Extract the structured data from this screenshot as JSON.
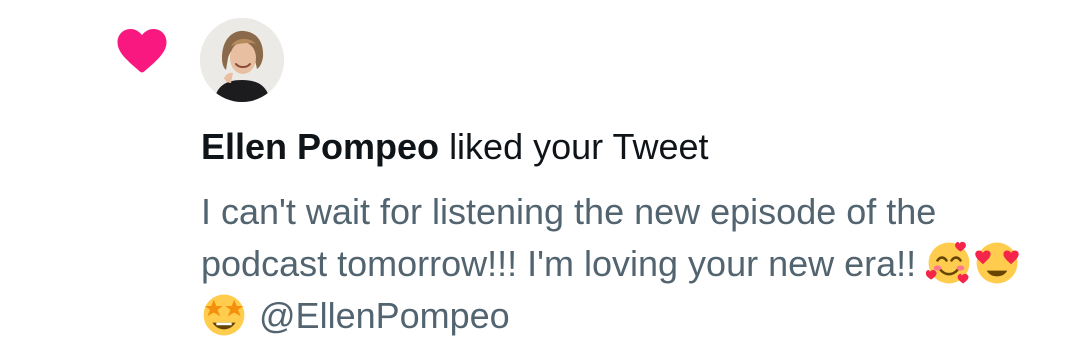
{
  "notification": {
    "type_icon": "heart-icon",
    "heart_color": "#f91880",
    "actor": {
      "name": "Ellen Pompeo",
      "avatar_icon": "user-avatar"
    },
    "action_text": "liked your Tweet",
    "tweet": {
      "text": "I can't wait for listening the new episode of the podcast tomorrow!!! I'm loving your new era!!",
      "emojis": [
        "smiling-face-with-hearts",
        "heart-eyes",
        "star-struck"
      ],
      "mention": "@EllenPompeo"
    }
  },
  "colors": {
    "primary_text": "#0f1419",
    "secondary_text": "#536471",
    "emoji_yellow": "#ffcc4d",
    "emoji_heart": "#f4244a"
  }
}
